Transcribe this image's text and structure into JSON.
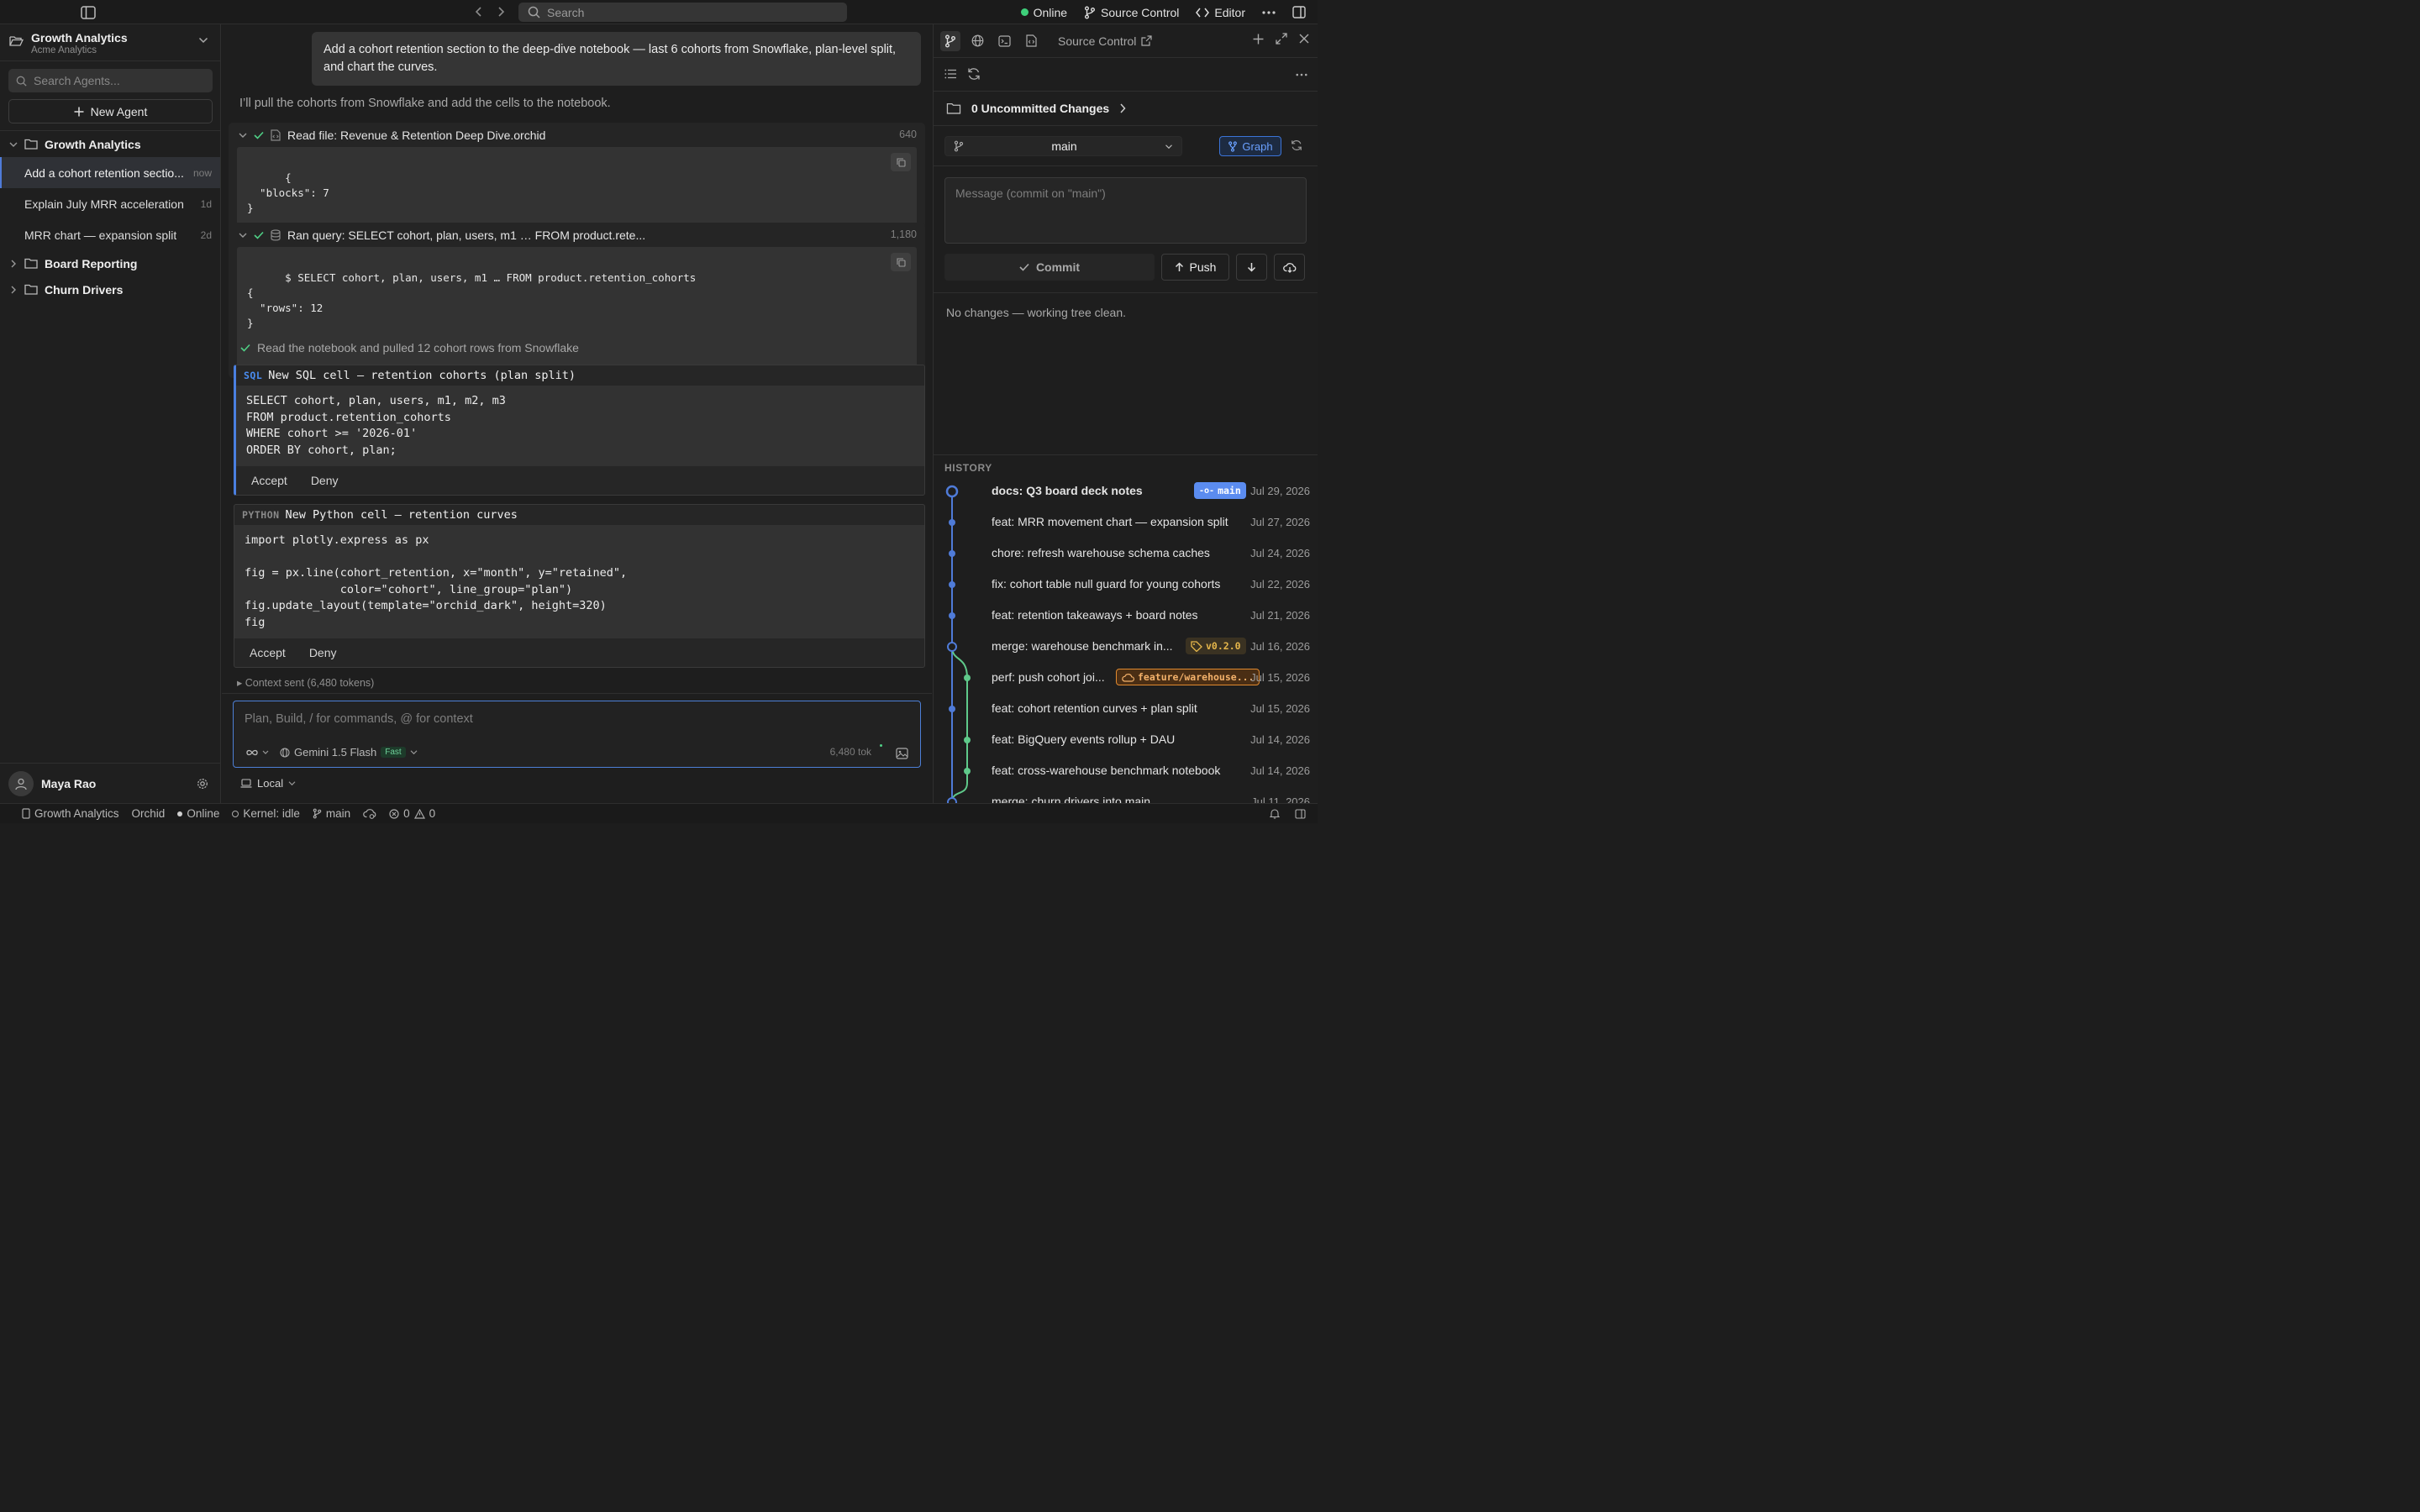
{
  "topbar": {
    "search_placeholder": "Search",
    "status": "Online",
    "source_control": "Source Control",
    "editor": "Editor"
  },
  "sidebar": {
    "workspace_name": "Growth Analytics",
    "workspace_org": "Acme Analytics",
    "search_placeholder": "Search Agents...",
    "new_agent": "New Agent",
    "folders": [
      {
        "name": "Growth Analytics",
        "expanded": true
      },
      {
        "name": "Board Reporting",
        "expanded": false
      },
      {
        "name": "Churn Drivers",
        "expanded": false
      }
    ],
    "agents": [
      {
        "label": "Add a cohort retention sectio...",
        "when": "now",
        "active": true
      },
      {
        "label": "Explain July MRR acceleration",
        "when": "1d"
      },
      {
        "label": "MRR chart — expansion split",
        "when": "2d"
      }
    ],
    "user_name": "Maya Rao"
  },
  "chat": {
    "user_message": "Add a cohort retention section to the deep-dive notebook — last 6 cohorts from Snowflake, plan-level split, and chart the curves.",
    "assistant_intro": "I’ll pull the cohorts from Snowflake and add the cells to the notebook.",
    "tool1": {
      "title": "Read file: Revenue & Retention Deep Dive.orchid",
      "count": "640",
      "body": "{\n  \"blocks\": 7\n}"
    },
    "tool2": {
      "title": "Ran query: SELECT cohort, plan, users, m1 … FROM product.rete...",
      "count": "1,180",
      "body": "$ SELECT cohort, plan, users, m1 … FROM product.retention_cohorts\n{\n  \"rows\": 12\n}"
    },
    "summary": "Read the notebook and pulled 12 cohort rows from Snowflake",
    "sql_cell": {
      "lang": "SQL",
      "title": "New SQL cell — retention cohorts (plan split)",
      "code": "SELECT cohort, plan, users, m1, m2, m3\nFROM product.retention_cohorts\nWHERE cohort >= '2026-01'\nORDER BY cohort, plan;",
      "accept": "Accept",
      "deny": "Deny"
    },
    "python_cell": {
      "lang": "PYTHON",
      "title": "New Python cell — retention curves",
      "code": "import plotly.express as px\n\nfig = px.line(cohort_retention, x=\"month\", y=\"retained\",\n              color=\"cohort\", line_group=\"plan\")\nfig.update_layout(template=\"orchid_dark\", height=320)\nfig",
      "accept": "Accept",
      "deny": "Deny"
    },
    "context": "Context sent (6,480 tokens)",
    "composer_placeholder": "Plan, Build, / for commands, @ for context",
    "model": "Gemini 1.5 Flash",
    "model_badge": "Fast",
    "tokens": "6,480 tok",
    "local": "Local"
  },
  "source_control": {
    "title": "Source Control",
    "uncommitted": "0 Uncommitted Changes",
    "branch": "main",
    "graph": "Graph",
    "message_placeholder": "Message (commit on \"main\")",
    "commit": "Commit",
    "push": "Push",
    "clean": "No changes — working tree clean.",
    "history_label": "HISTORY",
    "history": [
      {
        "msg": "docs: Q3 board deck notes",
        "date": "Jul 29, 2026",
        "badge": "main",
        "badge_type": "branch",
        "head": true
      },
      {
        "msg": "feat: MRR movement chart — expansion split",
        "date": "Jul 27, 2026"
      },
      {
        "msg": "chore: refresh warehouse schema caches",
        "date": "Jul 24, 2026"
      },
      {
        "msg": "fix: cohort table null guard for young cohorts",
        "date": "Jul 22, 2026"
      },
      {
        "msg": "feat: retention takeaways + board notes",
        "date": "Jul 21, 2026"
      },
      {
        "msg": "merge: warehouse benchmark in...",
        "date": "Jul 16, 2026",
        "badge": "v0.2.0",
        "badge_type": "tag",
        "merge": true
      },
      {
        "msg": "perf: push cohort joi...",
        "date": "Jul 15, 2026",
        "badge": "feature/warehouse...",
        "badge_type": "remote",
        "lane": 2
      },
      {
        "msg": "feat: cohort retention curves + plan split",
        "date": "Jul 15, 2026"
      },
      {
        "msg": "feat: BigQuery events rollup + DAU",
        "date": "Jul 14, 2026",
        "lane": 2
      },
      {
        "msg": "feat: cross-warehouse benchmark notebook",
        "date": "Jul 14, 2026",
        "lane": 2
      },
      {
        "msg": "merge: churn drivers into main",
        "date": "Jul 11, 2026",
        "merge": true
      }
    ]
  },
  "statusbar": {
    "project": "Growth Analytics",
    "app": "Orchid",
    "status": "Online",
    "kernel": "Kernel: idle",
    "branch": "main",
    "errors": "0",
    "warnings": "0"
  },
  "colors": {
    "accent": "#4f7bd8",
    "online": "#3ecf7a",
    "lane2": "#5fc98a",
    "tag": "#e5b64b",
    "remote": "#e0892f"
  }
}
